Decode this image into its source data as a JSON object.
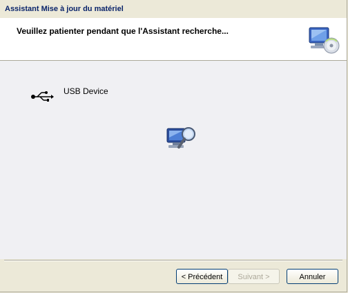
{
  "window": {
    "title": "Assistant Mise à jour du matériel"
  },
  "header": {
    "title": "Veuillez patienter pendant que l'Assistant recherche...",
    "icon": "hardware-wizard-icon"
  },
  "main": {
    "device": {
      "icon": "usb-icon",
      "label": "USB Device"
    },
    "animation_icon": "search-computer-icon"
  },
  "buttons": {
    "back_label": "< Précédent",
    "next_label": "Suivant >",
    "cancel_label": "Annuler"
  },
  "colors": {
    "title_text": "#0a246a",
    "window_bg": "#ece9d8",
    "header_bg": "#ffffff",
    "content_bg": "#f0f0f3"
  }
}
